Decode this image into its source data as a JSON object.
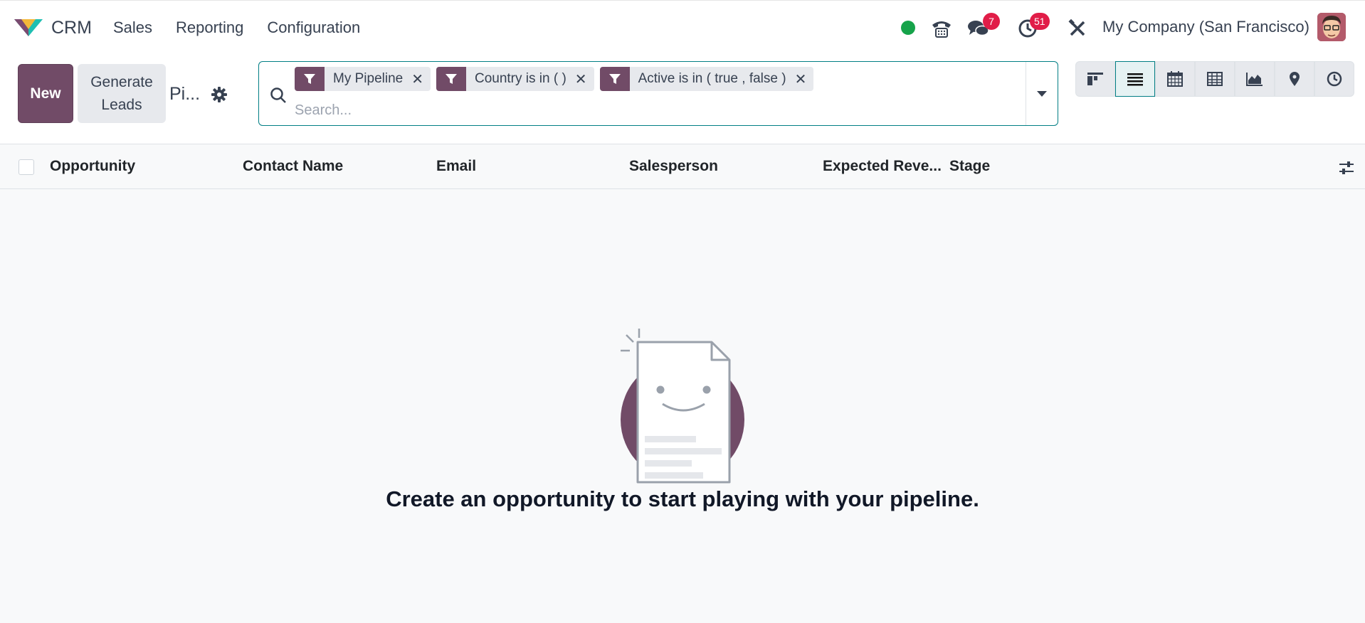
{
  "app": {
    "name": "CRM"
  },
  "menu": [
    {
      "label": "Sales"
    },
    {
      "label": "Reporting"
    },
    {
      "label": "Configuration"
    }
  ],
  "systray": {
    "status_color": "#16a34a",
    "messages_badge": "7",
    "activities_badge": "51",
    "company": "My Company (San Francisco)"
  },
  "control": {
    "new_label": "New",
    "generate_leads_label": "Generate Leads",
    "breadcrumb": "Pi..."
  },
  "search": {
    "placeholder": "Search...",
    "facets": [
      {
        "label": "My Pipeline"
      },
      {
        "label": "Country is in ( )"
      },
      {
        "label": "Active is in ( true , false )"
      }
    ]
  },
  "views": [
    "kanban-view-icon",
    "list-view-icon",
    "calendar-view-icon",
    "pivot-view-icon",
    "graph-view-icon",
    "map-view-icon",
    "activity-view-icon"
  ],
  "table": {
    "columns": [
      {
        "label": "Opportunity"
      },
      {
        "label": "Contact Name"
      },
      {
        "label": "Email"
      },
      {
        "label": "Salesperson"
      },
      {
        "label": "Expected Reve..."
      },
      {
        "label": "Stage"
      }
    ]
  },
  "empty_state": {
    "message": "Create an opportunity to start playing with your pipeline."
  },
  "colors": {
    "brand": "#714b67",
    "accent": "#017e84",
    "badge": "#e11d48"
  }
}
